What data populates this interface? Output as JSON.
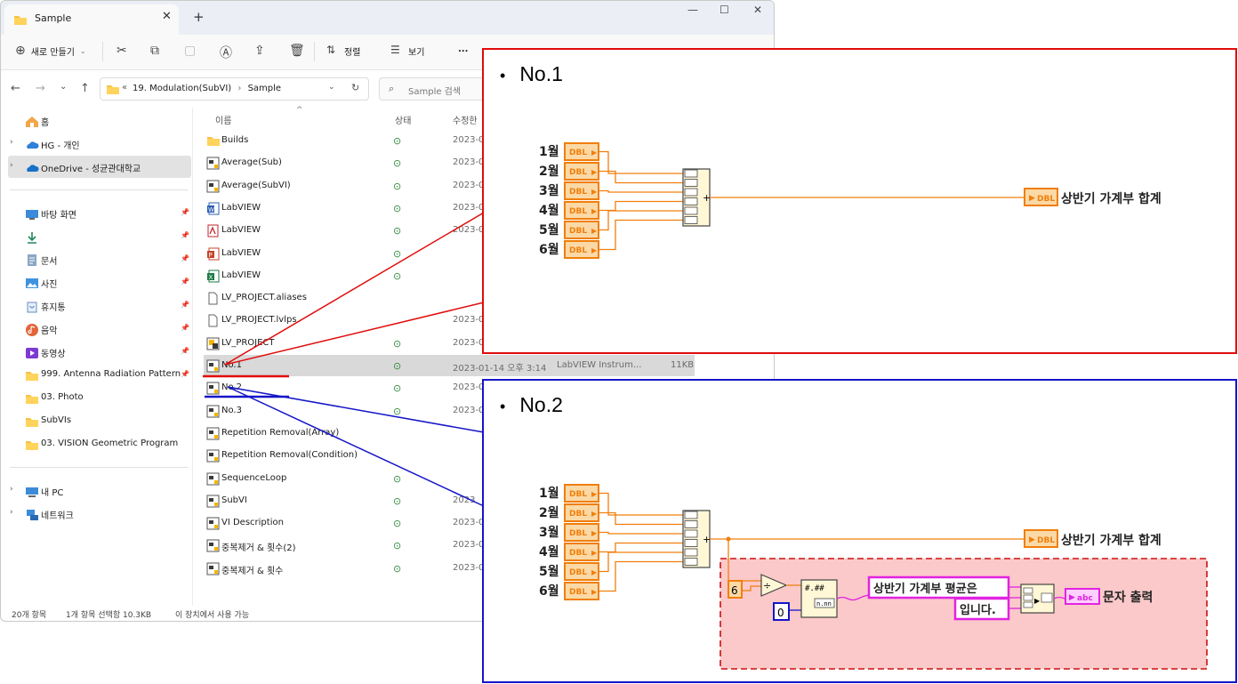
{
  "window": {
    "tab_title": "Sample",
    "new_button": "새로 만들기",
    "sort_label": "정렬",
    "view_label": "보기",
    "more_label": "...",
    "breadcrumb_prefix": "«",
    "breadcrumb": [
      "19. Modulation(SubVI)",
      "Sample"
    ],
    "search_placeholder": "Sample 검색"
  },
  "sidebar": {
    "top": [
      {
        "label": "홈",
        "icon": "home-icon"
      },
      {
        "label": "HG - 개인",
        "icon": "cloud-icon"
      },
      {
        "label": "OneDrive - 성균관대학교",
        "icon": "onedrive-icon",
        "selected": true
      }
    ],
    "quick": [
      {
        "label": "바탕 화면",
        "icon": "desktop-icon"
      },
      {
        "label": "",
        "icon": "download-icon"
      },
      {
        "label": "문서",
        "icon": "document-icon"
      },
      {
        "label": "사진",
        "icon": "photo-icon"
      },
      {
        "label": "휴지통",
        "icon": "recycle-bin-icon"
      },
      {
        "label": "음악",
        "icon": "music-icon"
      },
      {
        "label": "동영상",
        "icon": "video-icon"
      },
      {
        "label": "999. Antenna Radiation Pattern",
        "icon": "folder-icon"
      },
      {
        "label": "03. Photo",
        "icon": "folder-icon"
      },
      {
        "label": "SubVIs",
        "icon": "folder-icon"
      },
      {
        "label": "03. VISION Geometric Program",
        "icon": "folder-icon"
      }
    ],
    "bottom": [
      {
        "label": "내 PC",
        "icon": "pc-icon"
      },
      {
        "label": "네트워크",
        "icon": "network-icon"
      }
    ]
  },
  "columns": {
    "name": "이름",
    "status": "상태",
    "modified": "수정한"
  },
  "files": [
    {
      "name": "Builds",
      "icon": "folder-icon",
      "synced": true,
      "date": "2023-0"
    },
    {
      "name": "Average(Sub)",
      "icon": "vi-icon",
      "synced": true,
      "date": "2023-0"
    },
    {
      "name": "Average(SubVI)",
      "icon": "vi-icon",
      "synced": true,
      "date": "2023-0"
    },
    {
      "name": "LabVIEW",
      "icon": "word-icon",
      "synced": true,
      "date": "2023-0"
    },
    {
      "name": "LabVIEW",
      "icon": "pdf-icon",
      "synced": true,
      "date": "2023-0"
    },
    {
      "name": "LabVIEW",
      "icon": "ppt-icon",
      "synced": true,
      "date": ""
    },
    {
      "name": "LabVIEW",
      "icon": "excel-icon",
      "synced": true,
      "date": ""
    },
    {
      "name": "LV_PROJECT.aliases",
      "icon": "file-icon",
      "synced": false,
      "date": ""
    },
    {
      "name": "LV_PROJECT.lvlps",
      "icon": "file-icon",
      "synced": false,
      "date": "2023-0"
    },
    {
      "name": "LV_PROJECT",
      "icon": "project-icon",
      "synced": true,
      "date": "2023-0"
    },
    {
      "name": "No.1",
      "icon": "vi-icon",
      "synced": true,
      "date": "2023-01-14 오후 3:14",
      "type": "LabVIEW Instrum...",
      "size": "11KB",
      "selected": true
    },
    {
      "name": "No.2",
      "icon": "vi-icon",
      "synced": true,
      "date": "2023-0"
    },
    {
      "name": "No.3",
      "icon": "vi-icon",
      "synced": true,
      "date": "2023-0"
    },
    {
      "name": "Repetition Removal(Array)",
      "icon": "vi-icon",
      "synced": false,
      "date": ""
    },
    {
      "name": "Repetition Removal(Condition)",
      "icon": "vi-icon",
      "synced": false,
      "date": ""
    },
    {
      "name": "SequenceLoop",
      "icon": "vi-icon",
      "synced": true,
      "date": ""
    },
    {
      "name": "SubVI",
      "icon": "vi-icon",
      "synced": true,
      "date": "2023"
    },
    {
      "name": "VI Description",
      "icon": "vi-icon",
      "synced": true,
      "date": "2023-0"
    },
    {
      "name": "중복제거 & 횟수(2)",
      "icon": "vi-icon",
      "synced": true,
      "date": "2023-0"
    },
    {
      "name": "중복제거 & 횟수",
      "icon": "vi-icon",
      "synced": true,
      "date": "2023-0"
    }
  ],
  "status": {
    "count": "20개 항목",
    "selection": "1개 항목 선택함 10.3KB",
    "availability": "이 장치에서 사용 가능"
  },
  "panels": {
    "no1": {
      "bullet": "•",
      "title": "No.1",
      "inputs": [
        "1월",
        "2월",
        "3월",
        "4월",
        "5월",
        "6월"
      ],
      "type_tag": "DBL",
      "add_symbol": "+",
      "output_label": "상반기 가계부 합계"
    },
    "no2": {
      "bullet": "•",
      "title": "No.2",
      "inputs": [
        "1월",
        "2월",
        "3월",
        "4월",
        "5월",
        "6월"
      ],
      "type_tag": "DBL",
      "add_symbol": "+",
      "output_label": "상반기 가계부 합계",
      "divisor": "6",
      "precision": "0",
      "divide_symbol": "÷",
      "format_code": "#.##",
      "string_1": "상반기 가계부 평균은",
      "string_2": "입니다.",
      "string_tag": "abc",
      "string_output_label": "문자 출력"
    }
  },
  "colors": {
    "labview_orange": "#f07f0c",
    "labview_fill": "#fbd9a6",
    "string_pink": "#e223e2",
    "integer_blue": "#1515c8",
    "highlight_box": "#fbc9c9",
    "red_callout": "#e10b0b",
    "blue_callout": "#1515c8"
  }
}
